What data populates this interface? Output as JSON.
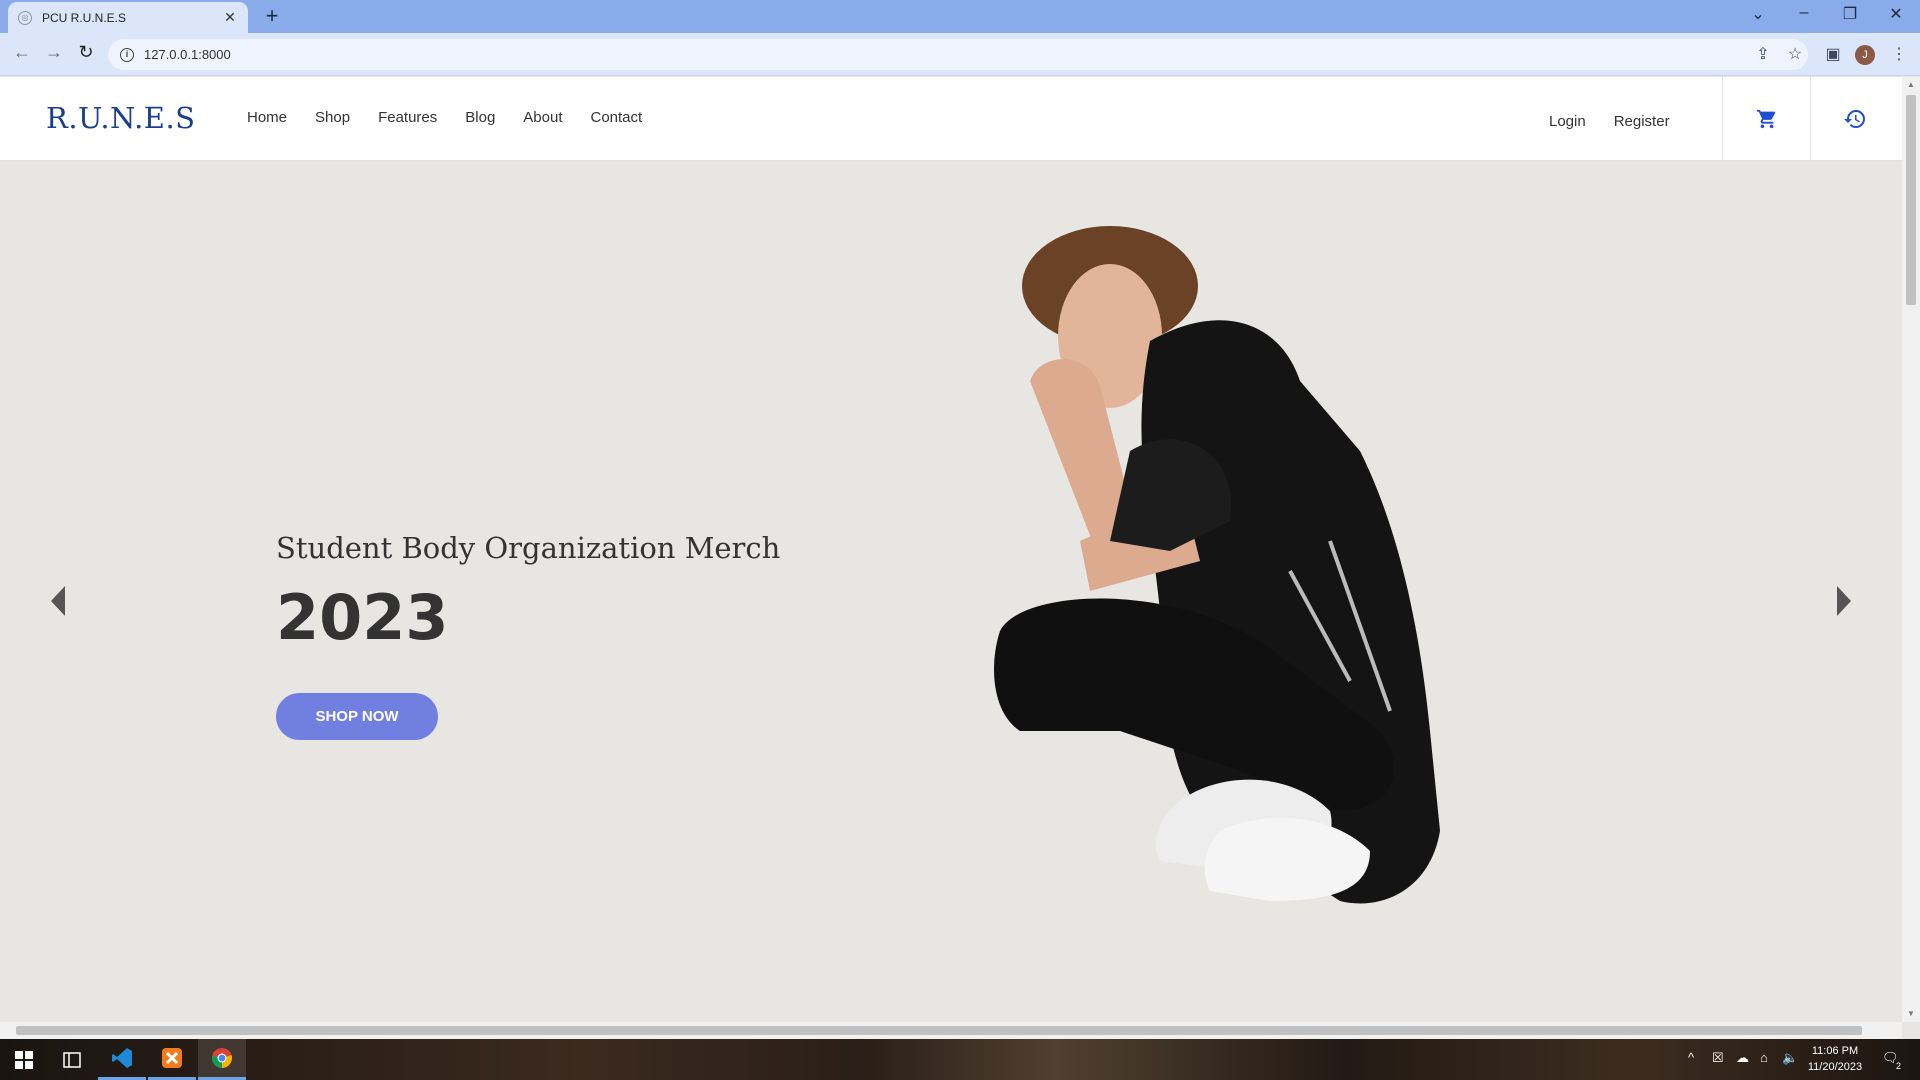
{
  "browser": {
    "tab_title": "PCU R.U.N.E.S",
    "url": "127.0.0.1:8000",
    "profile_initial": "J"
  },
  "site": {
    "logo": "R.U.N.E.S",
    "nav": [
      "Home",
      "Shop",
      "Features",
      "Blog",
      "About",
      "Contact"
    ],
    "auth": {
      "login": "Login",
      "register": "Register"
    },
    "icons": [
      "cart-icon",
      "history-icon"
    ],
    "accent_color": "#717fe0",
    "logo_color": "#1b3f8f"
  },
  "hero": {
    "subtitle": "Student Body Organization Merch",
    "year": "2023",
    "cta": "SHOP NOW"
  },
  "taskbar": {
    "time": "11:06 PM",
    "date": "11/20/2023",
    "notification_count": "2"
  }
}
